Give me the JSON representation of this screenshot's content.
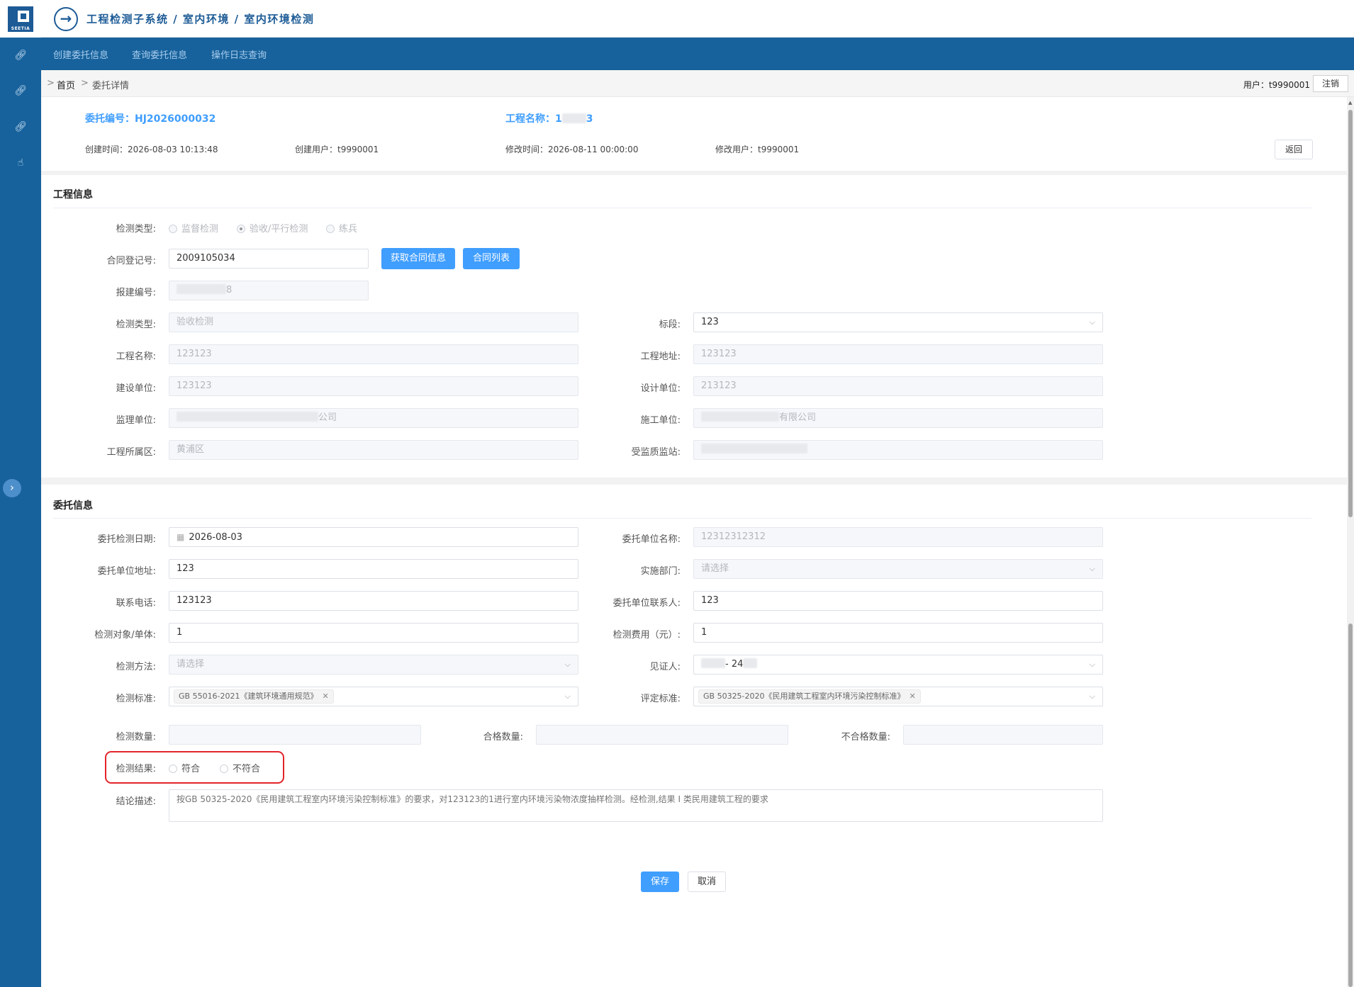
{
  "header": {
    "title": "工程检测子系统 / 室内环境 / 室内环境检测",
    "logo_text": "SEETIA"
  },
  "tabs": [
    "创建委托信息",
    "查询委托信息",
    "操作日志查询"
  ],
  "breadcrumb": {
    "sep": ">",
    "home": "首页",
    "current": "委托详情"
  },
  "user": {
    "label": "用户：t9990001",
    "logout": "注销"
  },
  "info": {
    "order_no": "委托编号：HJ2026000032",
    "project_name": "工程名称：1",
    "project_name_tail": "3",
    "created_time": "创建时间：2026-08-03 10:13:48",
    "created_user": "创建用户：t9990001",
    "modified_time": "修改时间：2026-08-11 00:00:00",
    "modified_user": "修改用户：t9990001",
    "back": "返回"
  },
  "project_section": {
    "title": "工程信息",
    "fields": {
      "check_type_label": "检测类型:",
      "check_type_options": [
        "监督检测",
        "验收/平行检测",
        "练兵"
      ],
      "check_type_selected": "验收/平行检测",
      "contract_no_label": "合同登记号:",
      "contract_no": "2009105034",
      "get_contract_btn": "获取合同信息",
      "contract_list_btn": "合同列表",
      "report_no_label": "报建编号:",
      "report_no_tail": "8",
      "detect_type_label": "检测类型:",
      "detect_type": "验收检测",
      "section_label": "标段:",
      "section": "123",
      "project_name_label": "工程名称:",
      "project_name": "123123",
      "project_addr_label": "工程地址:",
      "project_addr": "123123",
      "build_unit_label": "建设单位:",
      "build_unit": "123123",
      "design_unit_label": "设计单位:",
      "design_unit": "213123",
      "supervise_unit_label": "监理单位:",
      "supervise_unit_tail": "公司",
      "construct_unit_label": "施工单位:",
      "construct_unit_tail": "有限公司",
      "district_label": "工程所属区:",
      "district": "黄浦区",
      "station_label": "受监质监站:"
    }
  },
  "entrust_section": {
    "title": "委托信息",
    "fields": {
      "date_label": "委托检测日期:",
      "date": "2026-08-03",
      "unit_name_label": "委托单位名称:",
      "unit_name": "12312312312",
      "unit_addr_label": "委托单位地址:",
      "unit_addr": "123",
      "dept_label": "实施部门:",
      "dept_placeholder": "请选择",
      "phone_label": "联系电话:",
      "phone": "123123",
      "contact_label": "委托单位联系人:",
      "contact": "123",
      "object_label": "检测对象/单体:",
      "object": "1",
      "fee_label": "检测费用（元）:",
      "fee": "1",
      "method_label": "检测方法:",
      "method_placeholder": "请选择",
      "witness_label": "见证人:",
      "witness_mid": "- 24",
      "standard_label": "检测标准:",
      "standard_tag": "GB 55016-2021《建筑环境通用规范》",
      "eval_label": "评定标准:",
      "eval_tag": "GB 50325-2020《民用建筑工程室内环境污染控制标准》",
      "qty_label": "检测数量:",
      "pass_label": "合格数量:",
      "fail_label": "不合格数量:",
      "result_label": "检测结果:",
      "result_options": [
        "符合",
        "不符合"
      ],
      "conclusion_label": "结论描述:",
      "conclusion_placeholder": "按GB 50325-2020《民用建筑工程室内环境污染控制标准》的要求，对123123的1进行室内环境污染物浓度抽样检测。经检测,结果 I 类民用建筑工程的要求"
    }
  },
  "actions": {
    "save": "保存",
    "cancel": "取消"
  },
  "colors": {
    "sidebar": "#17629c",
    "accent": "#409eff",
    "highlight": "#e3242b"
  },
  "icons": [
    "link-icon",
    "link-icon",
    "link-icon",
    "hand-pointer-icon",
    "chevron-right-icon",
    "arrow-right-circle-icon",
    "calendar-icon",
    "chevron-down-icon"
  ]
}
